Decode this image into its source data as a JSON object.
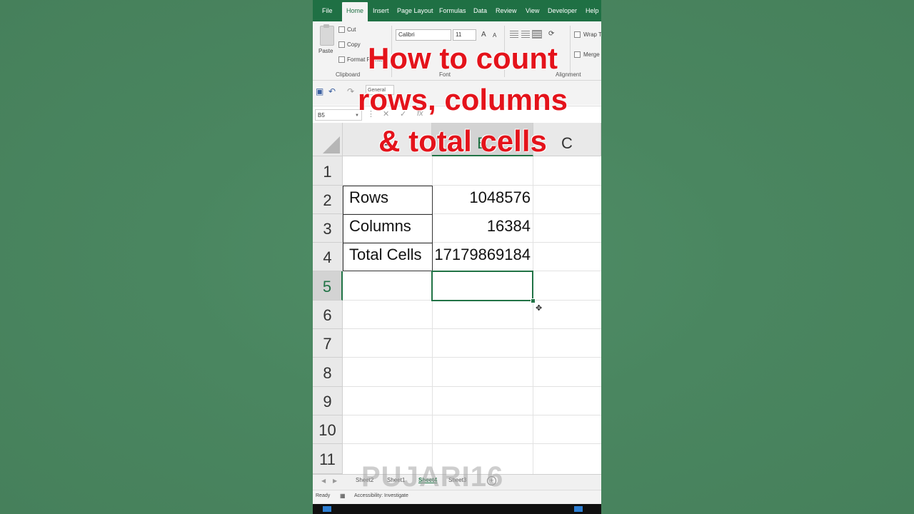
{
  "ribbon": {
    "tabs": [
      {
        "label": "File",
        "active": false
      },
      {
        "label": "Home",
        "active": true
      },
      {
        "label": "Insert",
        "active": false
      },
      {
        "label": "Page Layout",
        "active": false
      },
      {
        "label": "Formulas",
        "active": false
      },
      {
        "label": "Data",
        "active": false
      },
      {
        "label": "Review",
        "active": false
      },
      {
        "label": "View",
        "active": false
      },
      {
        "label": "Developer",
        "active": false
      },
      {
        "label": "Help",
        "active": false
      }
    ],
    "clipboard": {
      "paste": "Paste",
      "cut": "Cut",
      "copy": "Copy",
      "format_painter": "Format Painter",
      "group": "Clipboard"
    },
    "font": {
      "name": "Calibri",
      "size": "11",
      "group": "Font"
    },
    "alignment": {
      "wrap": "Wrap Text",
      "merge": "Merge & Center",
      "group": "Alignment"
    }
  },
  "quick_access": {
    "number_format": "General"
  },
  "formula_bar": {
    "name_box": "B5",
    "formula": ""
  },
  "grid": {
    "columns": [
      "A",
      "B",
      "C"
    ],
    "selected_column": "B",
    "rows": [
      "1",
      "2",
      "3",
      "4",
      "5",
      "6",
      "7",
      "8",
      "9",
      "10",
      "11"
    ],
    "selected_row": "5",
    "selected_cell": "B5",
    "cells": [
      {
        "ref": "A2",
        "value": "Rows",
        "number": "1048576"
      },
      {
        "ref": "A3",
        "value": "Columns",
        "number": "16384"
      },
      {
        "ref": "A4",
        "value": "Total Cells",
        "number": "17179869184"
      }
    ]
  },
  "sheet_tabs": [
    {
      "label": "Sheet2",
      "active": false
    },
    {
      "label": "Sheet1",
      "active": false
    },
    {
      "label": "Sheet4",
      "active": true
    },
    {
      "label": "Sheet3",
      "active": false
    }
  ],
  "status_bar": {
    "ready": "Ready",
    "accessibility": "Accessibility: Investigate"
  },
  "overlay": {
    "line1": "How to count",
    "line2": "rows, columns",
    "line3": "& total cells"
  },
  "watermark": "PUJARI16",
  "colors": {
    "excel_green": "#217346",
    "ribbon_green": "#1f7044",
    "overlay_red": "#e4131b",
    "background": "#4a8660"
  }
}
